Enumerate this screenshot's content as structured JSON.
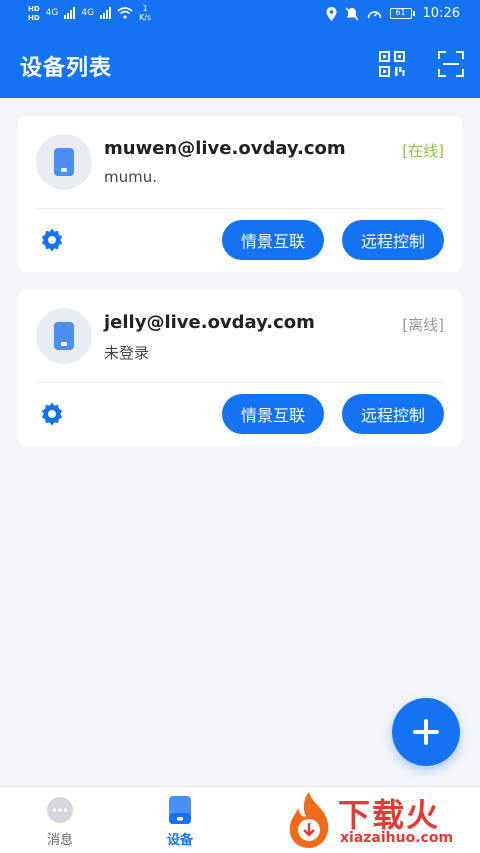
{
  "status_bar": {
    "time": "10:26",
    "battery": "61",
    "net_speed_value": "1",
    "net_speed_unit": "K/s",
    "signal_label_1": "4G",
    "signal_label_2": "4G"
  },
  "header": {
    "title": "设备列表",
    "icons": [
      "qr-code-icon",
      "scan-icon"
    ],
    "background_color": "#1473f2"
  },
  "devices": [
    {
      "email": "muwen@live.ovday.com",
      "subtitle": "mumu.",
      "status": "[在线]",
      "status_color": "#8bc34a",
      "scene_button": "情景互联",
      "remote_button": "远程控制"
    },
    {
      "email": "jelly@live.ovday.com",
      "subtitle": "未登录",
      "status": "[离线]",
      "status_color": "#999999",
      "scene_button": "情景互联",
      "remote_button": "远程控制"
    }
  ],
  "fab": {
    "icon": "plus-icon"
  },
  "bottom_nav": {
    "items": [
      {
        "label": "消息",
        "icon": "chat-bubble-icon",
        "active": false
      },
      {
        "label": "设备",
        "icon": "phone-device-icon",
        "active": true
      }
    ]
  },
  "watermark": {
    "text": "下载火",
    "url": "xiazaihuo.com"
  },
  "colors": {
    "accent": "#1473f2",
    "page_bg": "#f4f5f8",
    "online": "#8bc34a",
    "offline": "#999999"
  }
}
